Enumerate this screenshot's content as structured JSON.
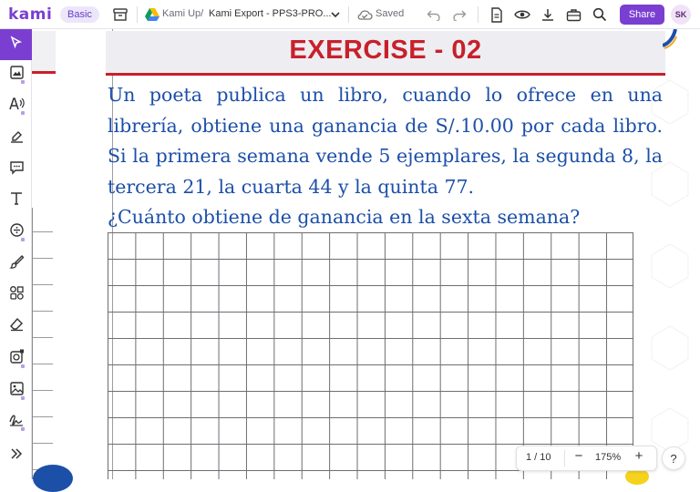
{
  "app": {
    "logo": "kami",
    "plan_badge": "Basic"
  },
  "breadcrumb": {
    "root": "Kami Up/",
    "file": "Kami Export - PPS3-PRO...",
    "status": "Saved"
  },
  "toolbar": {
    "share_label": "Share",
    "avatar_initials": "SK"
  },
  "left_tools": [
    {
      "name": "select-tool",
      "icon": "cursor-icon"
    },
    {
      "name": "markup-tool",
      "icon": "image-markup-icon"
    },
    {
      "name": "read-aloud-tool",
      "icon": "text-to-speech-icon"
    },
    {
      "name": "highlighter-tool",
      "icon": "highlighter-icon"
    },
    {
      "name": "comment-tool",
      "icon": "comment-icon"
    },
    {
      "name": "text-tool",
      "icon": "text-icon"
    },
    {
      "name": "equation-tool",
      "icon": "divide-icon"
    },
    {
      "name": "drawing-tool",
      "icon": "brush-icon"
    },
    {
      "name": "shapes-tool",
      "icon": "shapes-icon"
    },
    {
      "name": "eraser-tool",
      "icon": "eraser-icon"
    },
    {
      "name": "add-media-tool",
      "icon": "media-icon"
    },
    {
      "name": "insert-image-tool",
      "icon": "insert-image-icon"
    },
    {
      "name": "signature-tool",
      "icon": "signature-icon"
    },
    {
      "name": "expand-tool",
      "icon": "double-chevron-right-icon"
    }
  ],
  "document": {
    "title": "EXERCISE - 02",
    "problem": "Un poeta publica un libro, cuando lo ofrece en una librería, obtiene una ganancia de S/.10.00 por cada libro. Si la primera semana vende 5 ejemplares, la segunda 8, la tercera 21, la cuarta 44 y la quinta 77.",
    "question": "¿Cuánto obtiene de ganancia en la sexta semana?"
  },
  "zoom": {
    "page_indicator": "1 / 10",
    "zoom_level": "175%",
    "minus": "−",
    "plus": "+"
  },
  "help_label": "?",
  "colors": {
    "accent": "#7a3fd1",
    "title_red": "#c8202a",
    "text_blue": "#1c4fa8"
  }
}
